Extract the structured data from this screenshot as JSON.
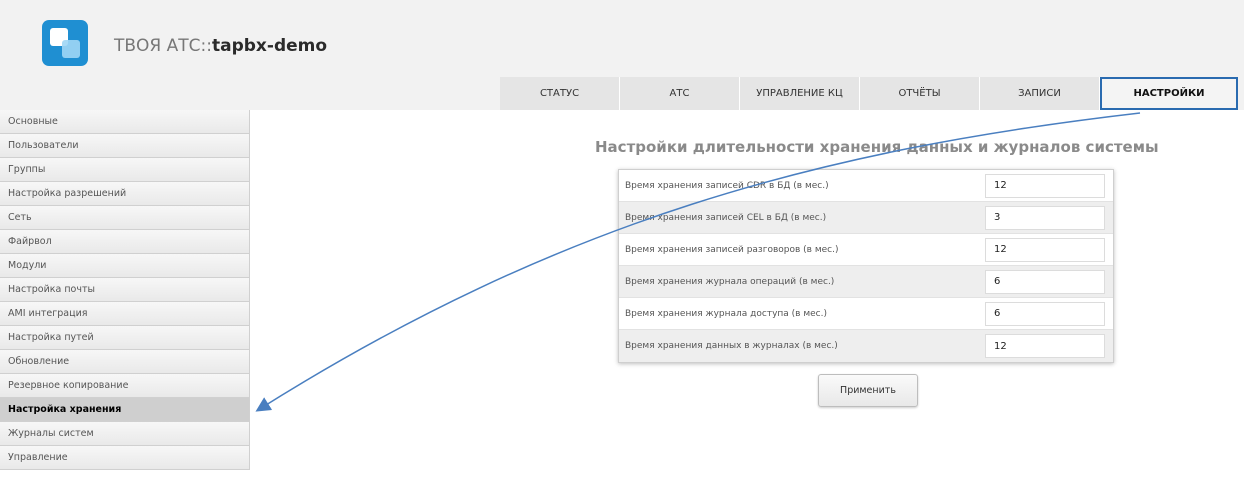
{
  "header": {
    "title_prefix": "ТВОЯ АТС::",
    "title_instance": "tapbx-demo"
  },
  "tabs": [
    {
      "label": "СТАТУС"
    },
    {
      "label": "АТС"
    },
    {
      "label": "УПРАВЛЕНИЕ КЦ"
    },
    {
      "label": "ОТЧЁТЫ"
    },
    {
      "label": "ЗАПИСИ"
    },
    {
      "label": "НАСТРОЙКИ",
      "active": true
    }
  ],
  "sidebar": {
    "items": [
      {
        "label": "Основные"
      },
      {
        "label": "Пользователи"
      },
      {
        "label": "Группы"
      },
      {
        "label": "Настройка разрешений"
      },
      {
        "label": "Сеть"
      },
      {
        "label": "Файрвол"
      },
      {
        "label": "Модули"
      },
      {
        "label": "Настройка почты"
      },
      {
        "label": "AMI интеграция"
      },
      {
        "label": "Настройка путей"
      },
      {
        "label": "Обновление"
      },
      {
        "label": "Резервное копирование"
      },
      {
        "label": "Настройка хранения",
        "active": true
      },
      {
        "label": "Журналы систем"
      },
      {
        "label": "Управление"
      }
    ]
  },
  "main": {
    "heading": "Настройки длительности хранения данных и журналов системы",
    "settings": [
      {
        "label": "Время хранения записей CDR в БД (в мес.)",
        "value": "12"
      },
      {
        "label": "Время хранения записей CEL в БД (в мес.)",
        "value": "3"
      },
      {
        "label": "Время хранения записей разговоров (в мес.)",
        "value": "12"
      },
      {
        "label": "Время хранения журнала операций (в мес.)",
        "value": "6"
      },
      {
        "label": "Время хранения журнала доступа (в мес.)",
        "value": "6"
      },
      {
        "label": "Время хранения данных в журналах (в мес.)",
        "value": "12"
      }
    ],
    "apply_label": "Применить"
  },
  "colors": {
    "accent": "#2a6bb0",
    "logo": "#1f8fd2",
    "annotation_arrow": "#4a7fc0"
  }
}
